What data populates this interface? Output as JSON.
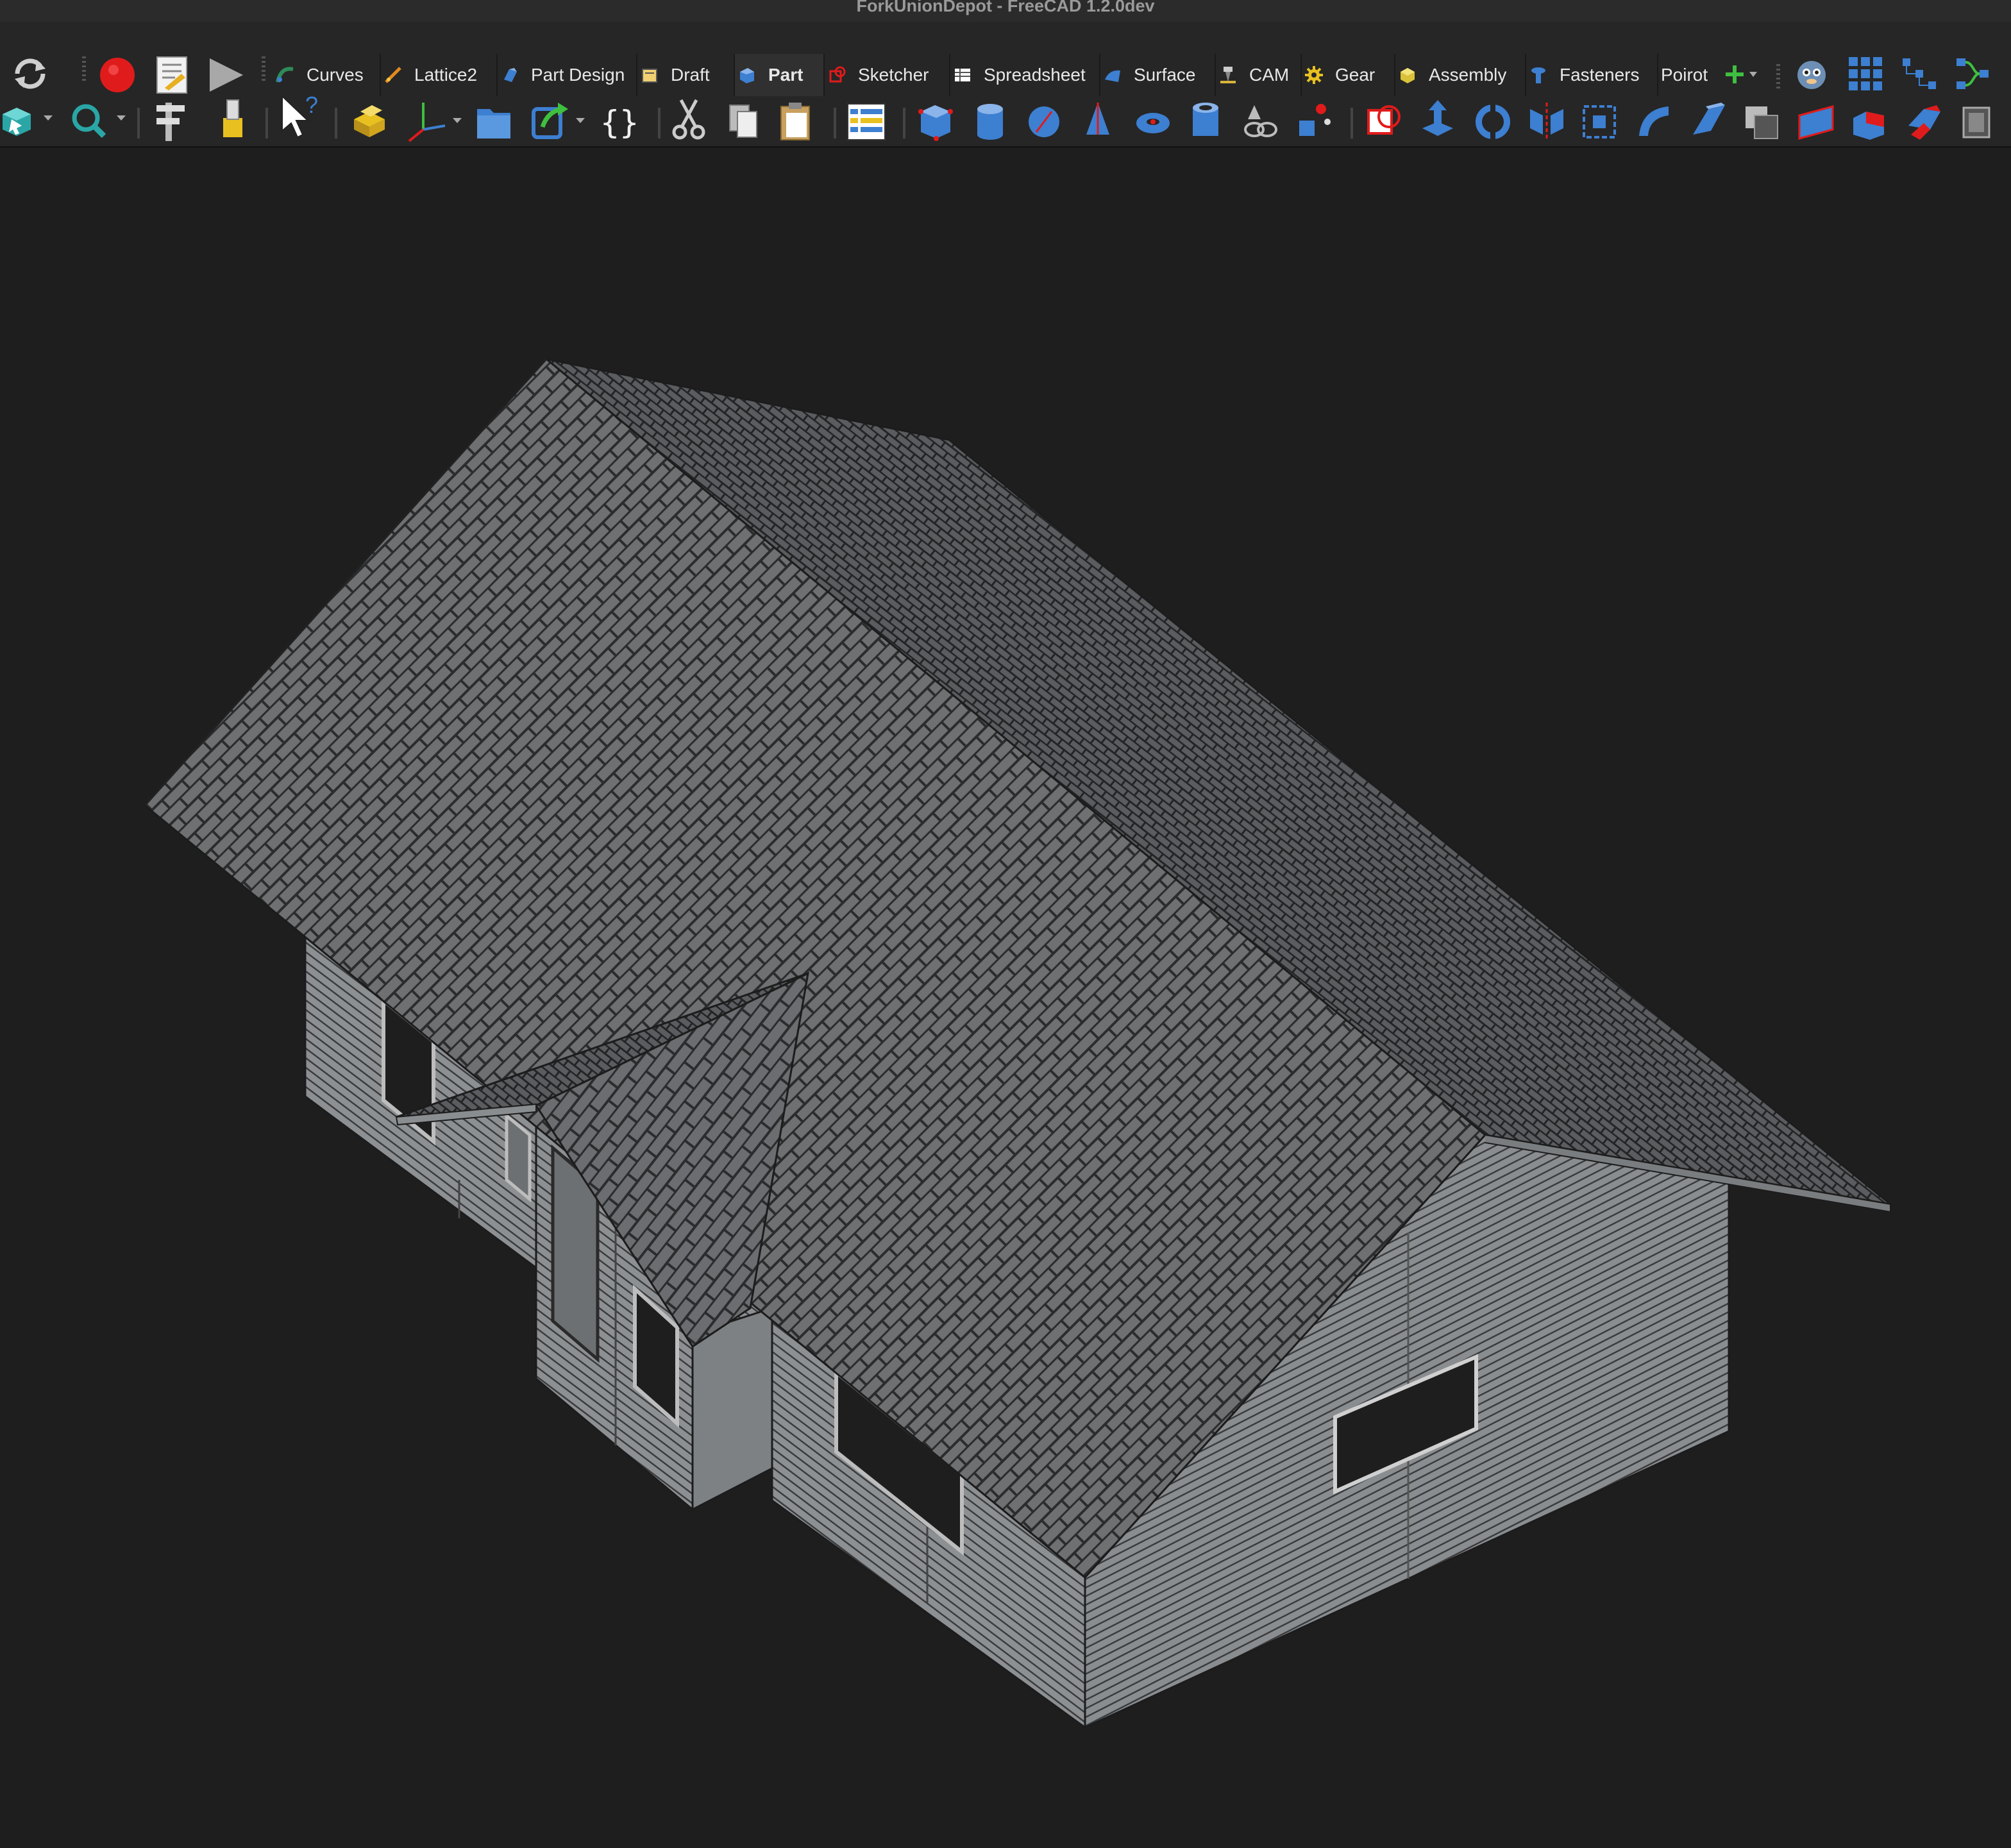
{
  "window": {
    "title": "ForkUnionDepot - FreeCAD 1.2.0dev"
  },
  "toolbar_main": {
    "workbenches": [
      {
        "label": "Curves",
        "icon": "curves-icon"
      },
      {
        "label": "Lattice2",
        "icon": "lattice2-icon"
      },
      {
        "label": "Part Design",
        "icon": "part-design-icon"
      },
      {
        "label": "Draft",
        "icon": "draft-icon"
      },
      {
        "label": "Part",
        "icon": "part-icon",
        "active": true
      },
      {
        "label": "Sketcher",
        "icon": "sketcher-icon"
      },
      {
        "label": "Spreadsheet",
        "icon": "spreadsheet-icon"
      },
      {
        "label": "Surface",
        "icon": "surface-icon"
      },
      {
        "label": "CAM",
        "icon": "cam-icon"
      },
      {
        "label": "Gear",
        "icon": "gear-icon"
      },
      {
        "label": "Assembly",
        "icon": "assembly-icon"
      },
      {
        "label": "Fasteners",
        "icon": "fasteners-icon"
      },
      {
        "label": "Poirot",
        "icon": ""
      }
    ]
  },
  "colors": {
    "background": "#1e1e1e",
    "toolbar": "#262626",
    "roof_main": "#6f7072",
    "roof_back": "#55575a",
    "wall": "#8d9093",
    "record_red": "#e01b1b",
    "accent_blue": "#3d7fd1"
  }
}
